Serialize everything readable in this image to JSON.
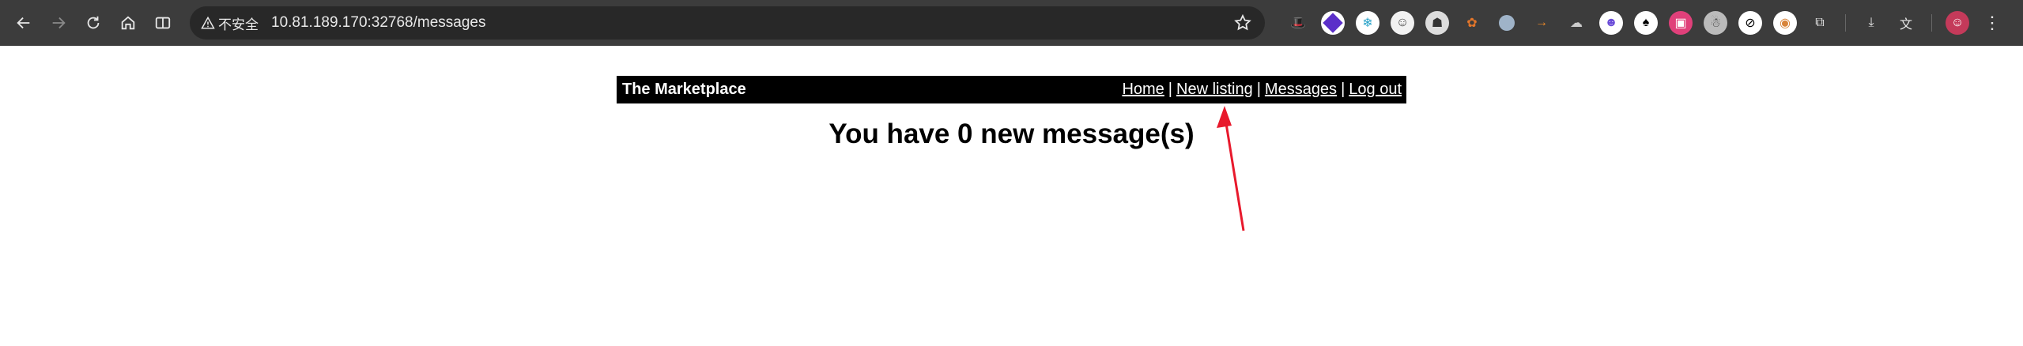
{
  "browser": {
    "security_label": "不安全",
    "url": "10.81.189.170:32768/messages"
  },
  "colors": {
    "chrome_bg": "#3c3c3c",
    "omnibox_bg": "#282828",
    "header_bg": "#000000",
    "annotation_arrow": "#e8192c"
  },
  "site": {
    "brand": "The Marketplace",
    "nav": {
      "home": "Home",
      "new_listing": "New listing",
      "messages": "Messages",
      "logout": "Log out",
      "separator": "|"
    },
    "heading": "You have 0 new message(s)"
  },
  "extensions": [
    "hat-icon",
    "layers-icon",
    "snowflake-icon",
    "face-icon",
    "ghost-icon",
    "cookie-icon",
    "circle-icon",
    "arrow-right-icon",
    "cloud-pause-icon",
    "cat-icon",
    "spade-icon",
    "image-icon",
    "portrait-icon",
    "block-icon",
    "donut-icon",
    "puzzle-icon"
  ]
}
